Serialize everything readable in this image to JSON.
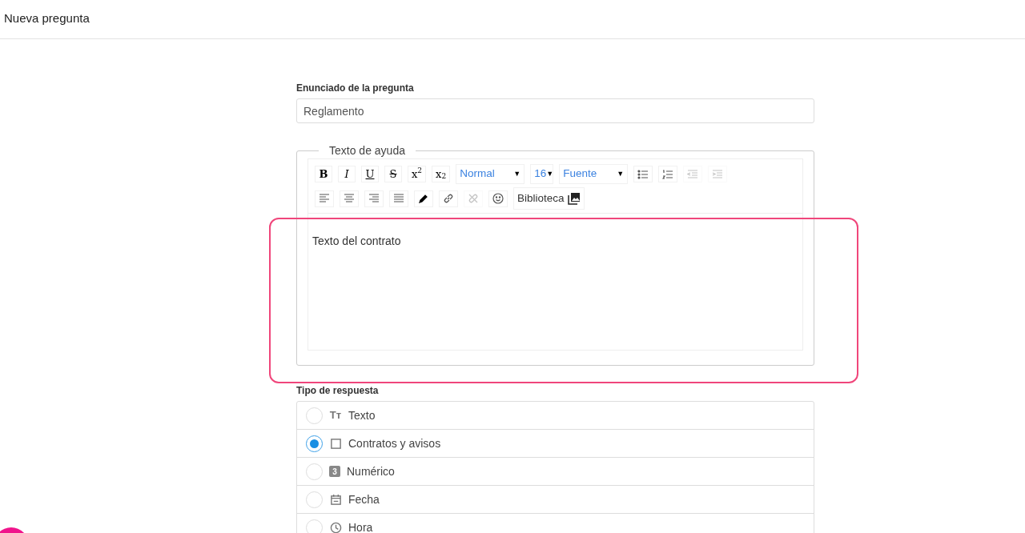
{
  "header": {
    "title": "Nueva pregunta"
  },
  "question": {
    "label": "Enunciado de la pregunta",
    "value": "Reglamento"
  },
  "help": {
    "legend": "Texto de ayuda",
    "toolbar_row_1": [
      {
        "kind": "text",
        "label": "B"
      },
      {
        "kind": "text",
        "label": "I"
      },
      {
        "kind": "text",
        "label": "U"
      },
      {
        "kind": "text",
        "label": "S"
      },
      {
        "kind": "sup",
        "label": "x",
        "mark": "2"
      },
      {
        "kind": "sub",
        "label": "x",
        "mark": "2"
      },
      {
        "kind": "select",
        "label": "Normal",
        "caret": "▼"
      },
      {
        "kind": "select",
        "label": "16",
        "caret": "▼"
      },
      {
        "kind": "select",
        "label": "Fuente",
        "caret": "▼"
      },
      {
        "kind": "icon",
        "disabled": false
      },
      {
        "kind": "icon",
        "disabled": false
      },
      {
        "kind": "icon",
        "disabled": true
      },
      {
        "kind": "icon",
        "disabled": true
      }
    ],
    "toolbar_row_2": [
      {
        "kind": "icon",
        "disabled": false
      },
      {
        "kind": "icon",
        "disabled": false
      },
      {
        "kind": "icon",
        "disabled": false
      },
      {
        "kind": "icon",
        "disabled": false
      },
      {
        "kind": "icon",
        "disabled": false
      },
      {
        "kind": "icon",
        "disabled": false
      },
      {
        "kind": "icon",
        "disabled": true
      },
      {
        "kind": "icon",
        "disabled": false
      },
      {
        "kind": "library",
        "label": "Biblioteca"
      }
    ],
    "content": "Texto del contrato"
  },
  "answer_type": {
    "label": "Tipo de respuesta",
    "options": [
      {
        "kind": "text",
        "icon": "Tт",
        "label": "Texto",
        "selected": false
      },
      {
        "kind": "checkbox",
        "label": "Contratos y avisos",
        "selected": true
      },
      {
        "kind": "number",
        "icon": "3",
        "label": "Numérico",
        "selected": false
      },
      {
        "kind": "date",
        "label": "Fecha",
        "selected": false
      },
      {
        "kind": "time",
        "label": "Hora",
        "selected": false
      }
    ]
  }
}
